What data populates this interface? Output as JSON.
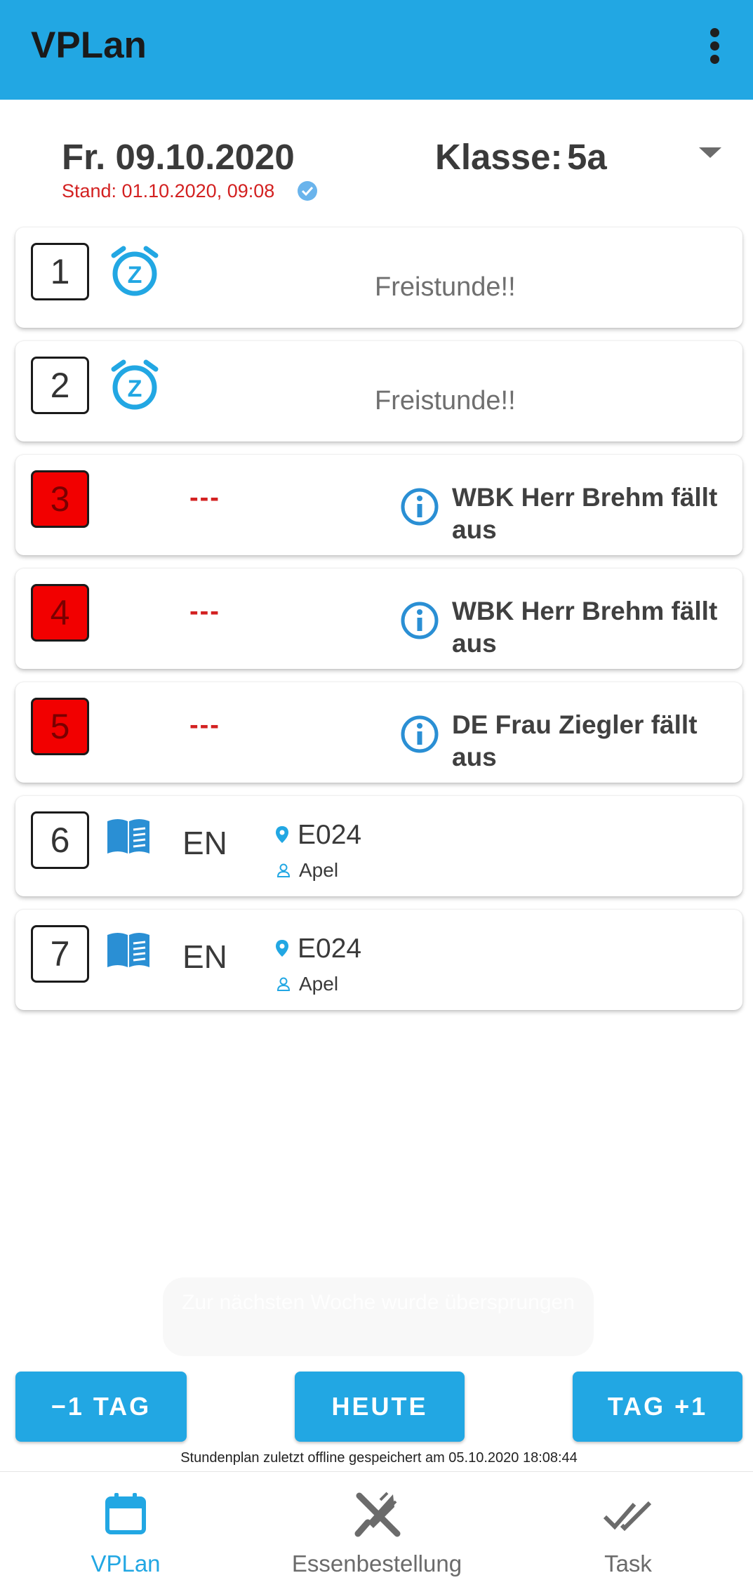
{
  "app": {
    "title": "VPLan"
  },
  "header": {
    "date": "Fr. 09.10.2020",
    "stand": "Stand: 01.10.2020, 09:08",
    "klasse_label": "Klasse:",
    "klasse_value": "5a"
  },
  "periods": [
    {
      "number": "1",
      "type": "free",
      "text": "Freistunde!!",
      "icon": "sleep-alarm-icon"
    },
    {
      "number": "2",
      "type": "free",
      "text": "Freistunde!!",
      "icon": "sleep-alarm-icon"
    },
    {
      "number": "3",
      "type": "cancelled",
      "dash": "---",
      "text": "WBK Herr Brehm fällt aus",
      "icon": "info-icon"
    },
    {
      "number": "4",
      "type": "cancelled",
      "dash": "---",
      "text": "WBK Herr Brehm fällt aus",
      "icon": "info-icon"
    },
    {
      "number": "5",
      "type": "cancelled",
      "dash": "---",
      "text": "DE Frau Ziegler fällt aus",
      "icon": "info-icon"
    },
    {
      "number": "6",
      "type": "lesson",
      "subject": "EN",
      "room": "E024",
      "teacher": "Apel",
      "icon": "book-icon"
    },
    {
      "number": "7",
      "type": "lesson",
      "subject": "EN",
      "room": "E024",
      "teacher": "Apel",
      "icon": "book-icon"
    }
  ],
  "toast": {
    "text": "Zur nächsten Woche wurde übersprungen"
  },
  "buttons": {
    "prev": "−1 TAG",
    "today": "HEUTE",
    "next": "TAG +1"
  },
  "offline_text": "Stundenplan zuletzt offline gespeichert am 05.10.2020 18:08:44",
  "nav": [
    {
      "label": "VPLan",
      "icon": "calendar-icon",
      "active": true
    },
    {
      "label": "Essenbestellung",
      "icon": "cutlery-icon",
      "active": false
    },
    {
      "label": "Task",
      "icon": "double-check-icon",
      "active": false
    }
  ],
  "colors": {
    "primary": "#22a7e3",
    "cancelled": "#f20000",
    "warning_text": "#d32121"
  }
}
